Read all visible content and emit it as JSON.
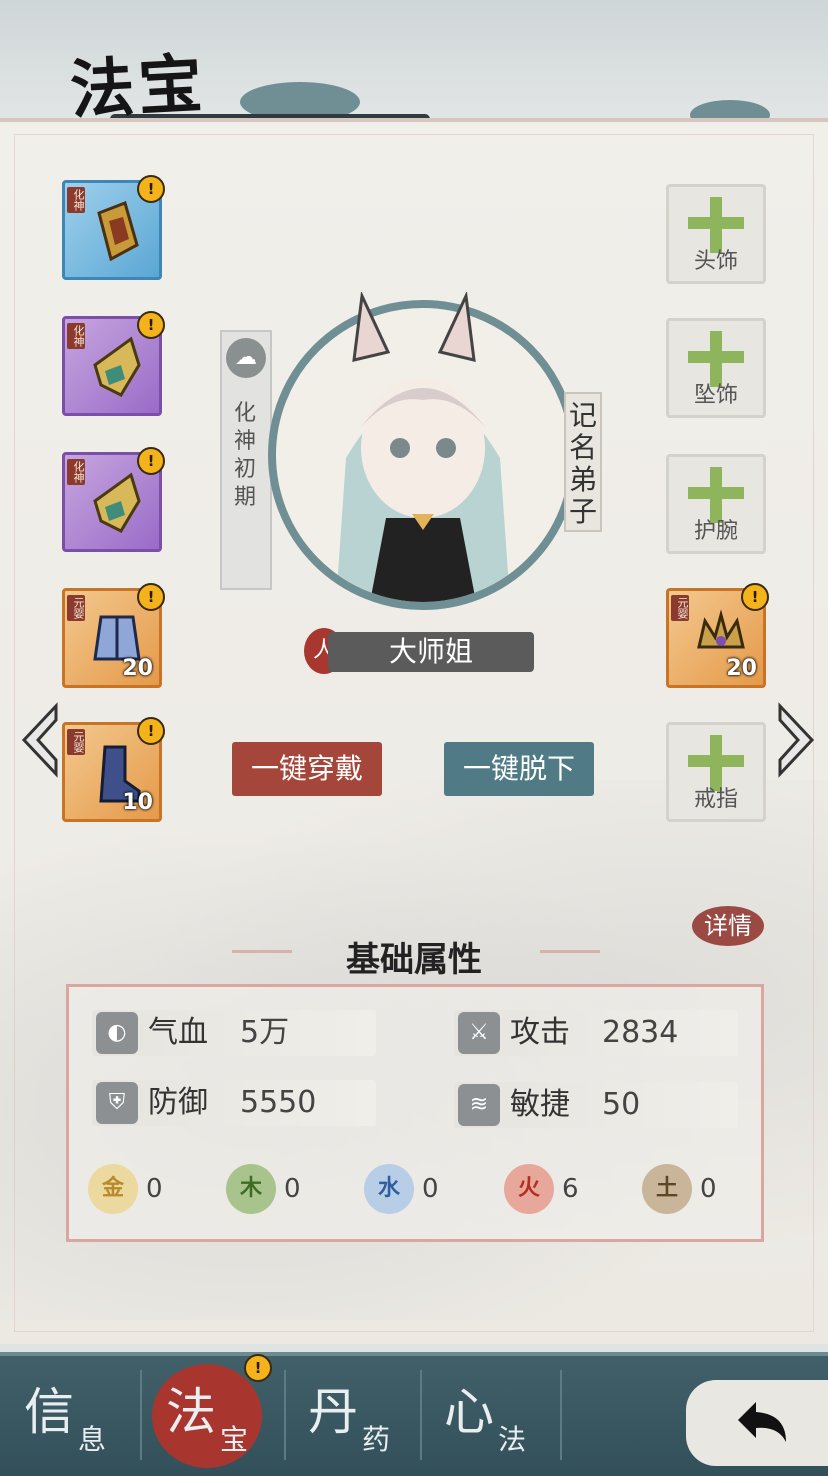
{
  "header": {
    "title": "法宝"
  },
  "left_slots": [
    {
      "tier": "化神",
      "alert": "!",
      "count": "",
      "color": "blue"
    },
    {
      "tier": "化神",
      "alert": "!",
      "count": "",
      "color": "purple"
    },
    {
      "tier": "化神",
      "alert": "!",
      "count": "",
      "color": "purple"
    },
    {
      "tier": "元婴",
      "alert": "!",
      "count": "20",
      "color": "orange"
    },
    {
      "tier": "元婴",
      "alert": "!",
      "count": "10",
      "color": "orange"
    }
  ],
  "right_slots": [
    {
      "label": "头饰"
    },
    {
      "label": "坠饰"
    },
    {
      "label": "护腕"
    },
    {
      "tier": "元婴",
      "alert": "!",
      "count": "20"
    },
    {
      "label": "戒指"
    }
  ],
  "character": {
    "realm": "化神初期",
    "rank": "记名弟子",
    "name": "大师姐",
    "name_icon": "人"
  },
  "actions": {
    "equip_all": "一键穿戴",
    "unequip_all": "一键脱下"
  },
  "stats": {
    "detail_label": "详情",
    "section_title": "基础属性",
    "hp": {
      "label": "气血",
      "value": "5万"
    },
    "attack": {
      "label": "攻击",
      "value": "2834"
    },
    "defense": {
      "label": "防御",
      "value": "5550"
    },
    "agility": {
      "label": "敏捷",
      "value": "50"
    },
    "elements": [
      {
        "name": "金",
        "value": "0",
        "color": "#d9b24a"
      },
      {
        "name": "木",
        "value": "0",
        "color": "#6f9a4b"
      },
      {
        "name": "水",
        "value": "0",
        "color": "#4f7fb7"
      },
      {
        "name": "火",
        "value": "6",
        "color": "#d0493a"
      },
      {
        "name": "土",
        "value": "0",
        "color": "#9a7a55"
      }
    ]
  },
  "tabs": [
    {
      "big": "信",
      "small": "息",
      "active": false
    },
    {
      "big": "法",
      "small": "宝",
      "active": true,
      "alert": "!"
    },
    {
      "big": "丹",
      "small": "药",
      "active": false
    },
    {
      "big": "心",
      "small": "法",
      "active": false
    }
  ]
}
